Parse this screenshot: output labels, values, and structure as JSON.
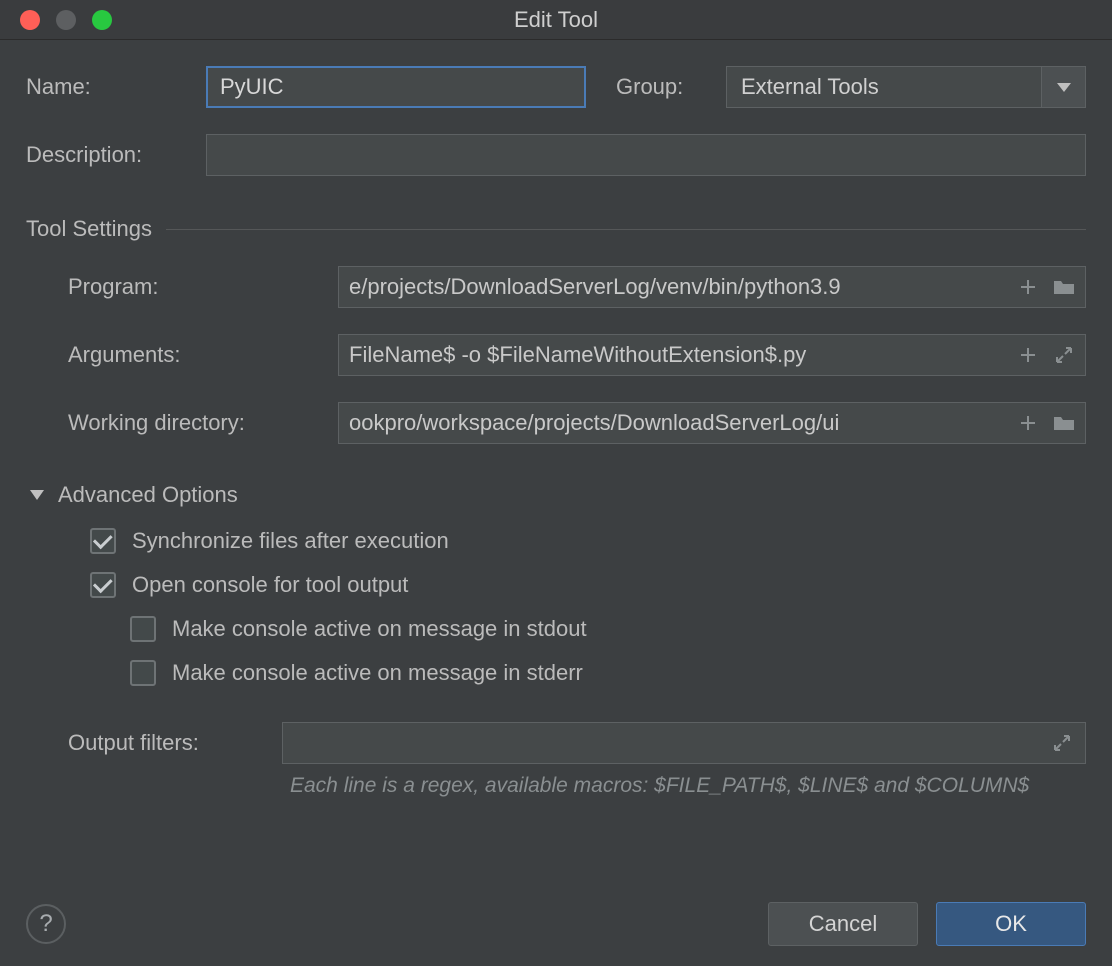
{
  "window": {
    "title": "Edit Tool"
  },
  "labels": {
    "name": "Name:",
    "group": "Group:",
    "description": "Description:",
    "tool_settings": "Tool Settings",
    "program": "Program:",
    "arguments": "Arguments:",
    "working_dir": "Working directory:",
    "advanced": "Advanced Options",
    "sync_files": "Synchronize files after execution",
    "open_console": "Open console for tool output",
    "active_stdout": "Make console active on message in stdout",
    "active_stderr": "Make console active on message in stderr",
    "output_filters": "Output filters:",
    "hint": "Each line is a regex, available macros: $FILE_PATH$, $LINE$ and $COLUMN$"
  },
  "values": {
    "name": "PyUIC",
    "group": "External Tools",
    "description": "",
    "program": "e/projects/DownloadServerLog/venv/bin/python3.9",
    "arguments": "FileName$ -o $FileNameWithoutExtension$.py",
    "working_dir": "ookpro/workspace/projects/DownloadServerLog/ui",
    "sync_files_checked": true,
    "open_console_checked": true,
    "active_stdout_checked": false,
    "active_stderr_checked": false,
    "output_filters": ""
  },
  "buttons": {
    "cancel": "Cancel",
    "ok": "OK",
    "help": "?"
  }
}
